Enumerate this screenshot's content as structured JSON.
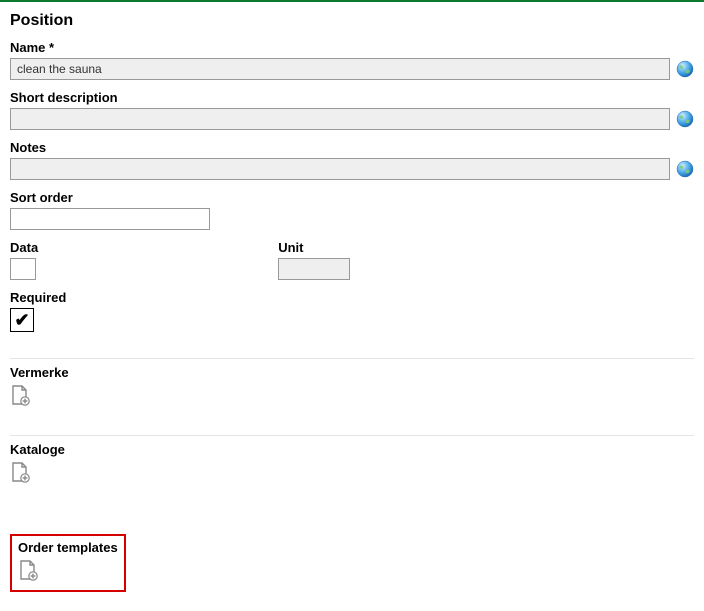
{
  "header": {
    "title": "Position"
  },
  "fields": {
    "name": {
      "label": "Name *",
      "value": "clean the sauna"
    },
    "shortDescription": {
      "label": "Short description",
      "value": ""
    },
    "notes": {
      "label": "Notes",
      "value": ""
    },
    "sortOrder": {
      "label": "Sort order",
      "value": ""
    },
    "data": {
      "label": "Data",
      "value": ""
    },
    "unit": {
      "label": "Unit",
      "value": ""
    },
    "required": {
      "label": "Required",
      "checked": true,
      "mark": "✔"
    }
  },
  "subsections": {
    "vermerke": {
      "label": "Vermerke"
    },
    "kataloge": {
      "label": "Kataloge"
    },
    "orderTemplates": {
      "label": "Order templates"
    }
  }
}
